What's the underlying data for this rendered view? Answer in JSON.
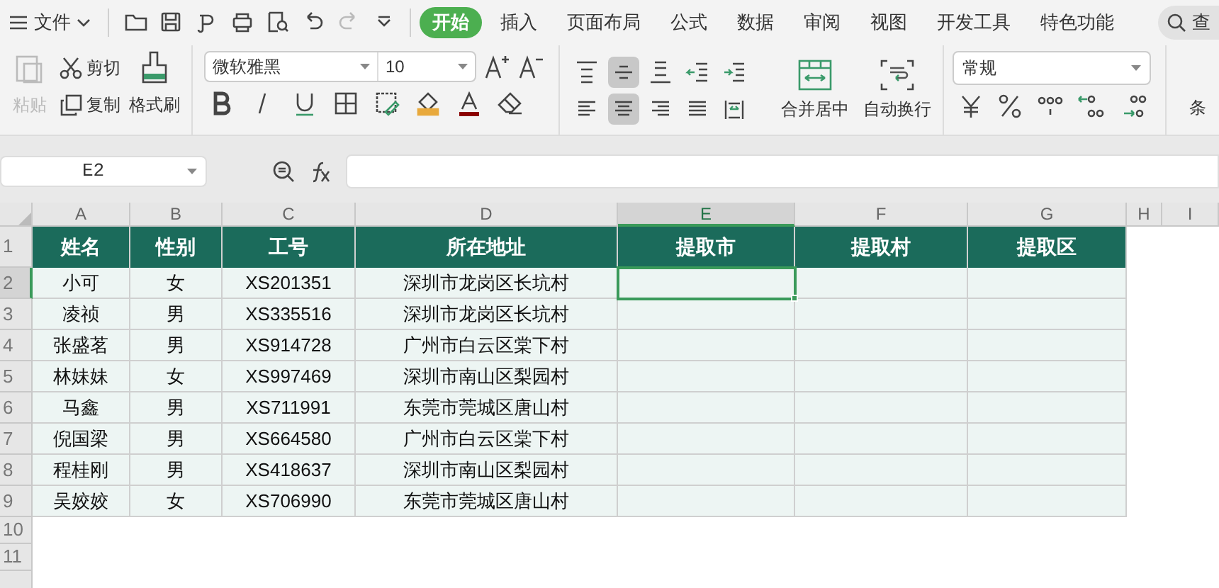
{
  "menu_bar": {
    "menu_label": "文件",
    "tabs": [
      {
        "label": "开始",
        "selected": true
      },
      {
        "label": "插入",
        "selected": false
      },
      {
        "label": "页面布局",
        "selected": false
      },
      {
        "label": "公式",
        "selected": false
      },
      {
        "label": "数据",
        "selected": false
      },
      {
        "label": "审阅",
        "selected": false
      },
      {
        "label": "视图",
        "selected": false
      },
      {
        "label": "开发工具",
        "selected": false
      },
      {
        "label": "特色功能",
        "selected": false
      }
    ],
    "search_label": "查"
  },
  "ribbon": {
    "paste": {
      "label": "粘贴",
      "disabled": true
    },
    "cut": "剪切",
    "copy": "复制",
    "format_painter": "格式刷",
    "font_name": "微软雅黑",
    "font_size": "10",
    "align_buttons": [
      {
        "kind": "top",
        "selected": false
      },
      {
        "kind": "middle",
        "selected": true
      },
      {
        "kind": "bottom",
        "selected": false
      },
      {
        "kind": "outdent",
        "selected": false
      },
      {
        "kind": "indent",
        "selected": false
      },
      {
        "kind": "left",
        "selected": false
      },
      {
        "kind": "center",
        "selected": true
      },
      {
        "kind": "right",
        "selected": false
      },
      {
        "kind": "justify",
        "selected": false
      },
      {
        "kind": "distribute",
        "selected": false
      }
    ],
    "merge": "合并居中",
    "wrap": "自动换行",
    "number_format": "常规",
    "group_cut": "条"
  },
  "formula_bar": {
    "name_box": "E2"
  },
  "sheet": {
    "columns": [
      {
        "label": "A",
        "selected": false
      },
      {
        "label": "B",
        "selected": false
      },
      {
        "label": "C",
        "selected": false
      },
      {
        "label": "D",
        "selected": false
      },
      {
        "label": "E",
        "selected": true
      },
      {
        "label": "F",
        "selected": false
      },
      {
        "label": "G",
        "selected": false
      },
      {
        "label": "H",
        "selected": false
      },
      {
        "label": "I",
        "selected": false
      }
    ],
    "rows": [
      {
        "number": "1",
        "kind": "header",
        "selected": false,
        "cells": [
          "姓名",
          "性别",
          "工号",
          "所在地址",
          "提取市",
          "提取村",
          "提取区"
        ]
      },
      {
        "number": "2",
        "kind": "data",
        "selected": true,
        "cells": [
          "小可",
          "女",
          "XS201351",
          "深圳市龙岗区长坑村"
        ]
      },
      {
        "number": "3",
        "kind": "data",
        "selected": false,
        "cells": [
          "凌祯",
          "男",
          "XS335516",
          "深圳市龙岗区长坑村"
        ]
      },
      {
        "number": "4",
        "kind": "data",
        "selected": false,
        "cells": [
          "张盛茗",
          "男",
          "XS914728",
          "广州市白云区棠下村"
        ]
      },
      {
        "number": "5",
        "kind": "data",
        "selected": false,
        "cells": [
          "林妹妹",
          "女",
          "XS997469",
          "深圳市南山区梨园村"
        ]
      },
      {
        "number": "6",
        "kind": "data",
        "selected": false,
        "cells": [
          "马鑫",
          "男",
          "XS711991",
          "东莞市莞城区唐山村"
        ]
      },
      {
        "number": "7",
        "kind": "data",
        "selected": false,
        "cells": [
          "倪国梁",
          "男",
          "XS664580",
          "广州市白云区棠下村"
        ]
      },
      {
        "number": "8",
        "kind": "data",
        "selected": false,
        "cells": [
          "程桂刚",
          "男",
          "XS418637",
          "深圳市南山区梨园村"
        ]
      },
      {
        "number": "9",
        "kind": "data",
        "selected": false,
        "cells": [
          "吴姣姣",
          "女",
          "XS706990",
          "东莞市莞城区唐山村"
        ]
      },
      {
        "number": "10",
        "kind": "empty",
        "selected": false,
        "cells": []
      },
      {
        "number": "11",
        "kind": "empty",
        "selected": false,
        "cells": []
      }
    ]
  }
}
